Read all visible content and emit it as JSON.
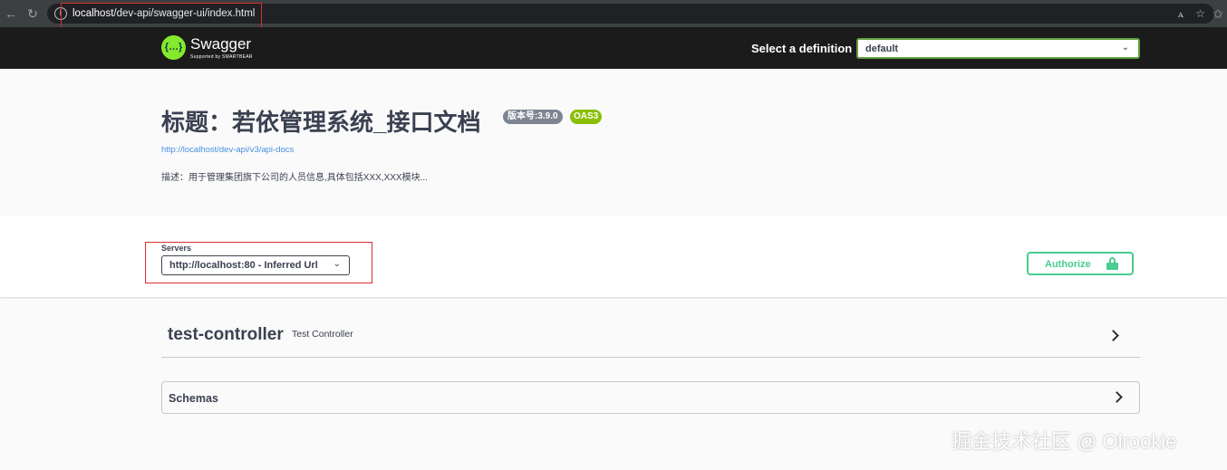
{
  "browser": {
    "url_host": "localhost",
    "url_path": "/dev-api/swagger-ui/index.html"
  },
  "topbar": {
    "logo_text": "Swagger",
    "logo_subtext": "Supported by SMARTBEAR",
    "definition_label": "Select a definition",
    "definition_value": "default"
  },
  "info": {
    "title": "标题：若依管理系统_接口文档",
    "version_badge": "版本号:3.9.0",
    "oas_badge": "OAS3",
    "spec_url": "http://localhost/dev-api/v3/api-docs",
    "description": "描述：用于管理集团旗下公司的人员信息,具体包括XXX,XXX模块..."
  },
  "servers": {
    "label": "Servers",
    "selected": "http://localhost:80 - Inferred Url"
  },
  "authorize": {
    "label": "Authorize"
  },
  "tags": [
    {
      "name": "test-controller",
      "description": "Test Controller"
    }
  ],
  "schemas": {
    "title": "Schemas"
  },
  "watermark": "掘金技术社区 @ Olrookie",
  "colors": {
    "swagger_green": "#85ea2d",
    "authorize_green": "#49cc90",
    "oas_green": "#89bf04",
    "link_blue": "#4990e2",
    "highlight_red": "#d93030"
  }
}
